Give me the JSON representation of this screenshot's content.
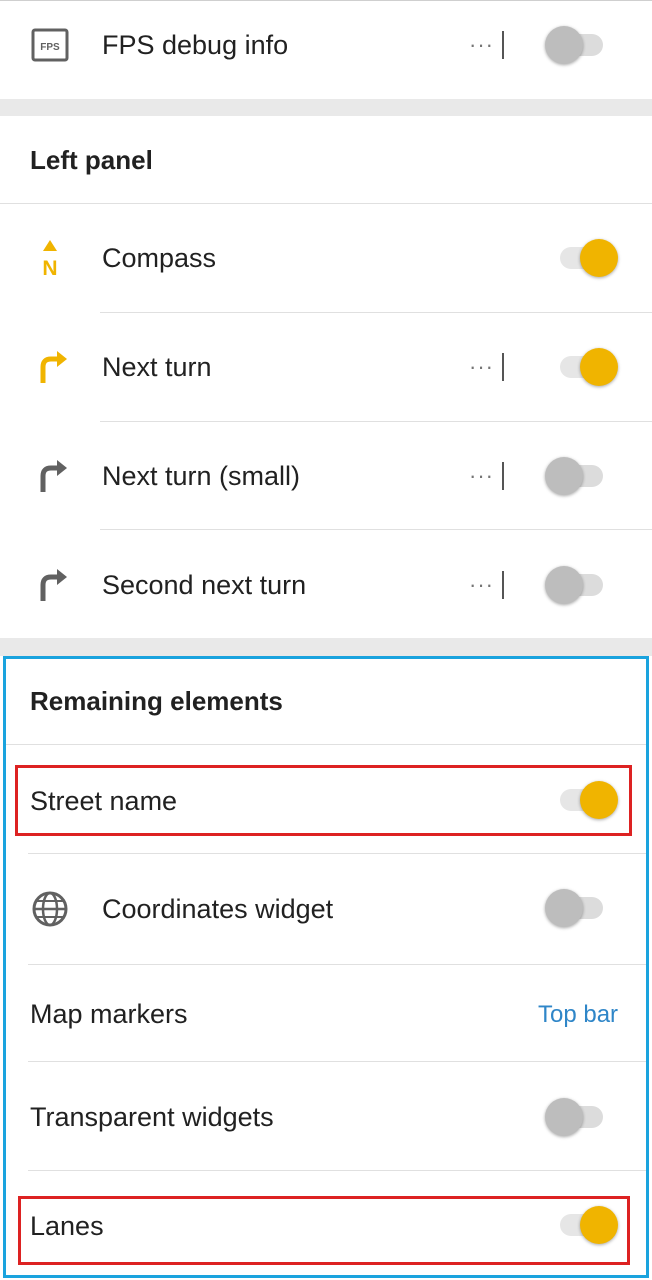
{
  "fps_row": {
    "label": "FPS debug info",
    "icon": "fps-icon",
    "more": "···",
    "enabled": false
  },
  "left_panel": {
    "header": "Left panel",
    "items": [
      {
        "label": "Compass",
        "icon": "compass-icon",
        "has_more": false,
        "enabled": true
      },
      {
        "label": "Next turn",
        "icon": "next-turn-icon",
        "has_more": true,
        "enabled": true
      },
      {
        "label": "Next turn (small)",
        "icon": "next-turn-small-icon",
        "has_more": true,
        "enabled": false
      },
      {
        "label": "Second next turn",
        "icon": "second-next-turn-icon",
        "has_more": true,
        "enabled": false
      }
    ],
    "more": "···"
  },
  "remaining": {
    "header": "Remaining elements",
    "street_name": {
      "label": "Street name",
      "enabled": true
    },
    "coordinates": {
      "label": "Coordinates widget",
      "icon": "globe-icon",
      "enabled": false
    },
    "map_markers": {
      "label": "Map markers",
      "value": "Top bar"
    },
    "transparent": {
      "label": "Transparent widgets",
      "enabled": false
    },
    "lanes": {
      "label": "Lanes",
      "enabled": true
    }
  },
  "colors": {
    "accent": "#f0b400",
    "link": "#2f86c8",
    "highlight_blue": "#1aa3de",
    "highlight_red": "#dd2222"
  }
}
